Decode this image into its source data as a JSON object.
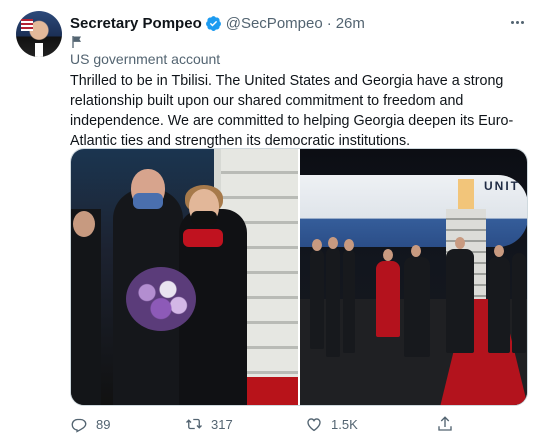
{
  "author": {
    "name": "Secretary Pompeo",
    "handle": "@SecPompeo",
    "separator": "·",
    "time": "26m",
    "account_label": "US government account"
  },
  "tweet": {
    "text": "Thrilled to be in Tbilisi. The United States and Georgia have a strong relationship built upon our shared commitment to freedom and independence. We are committed to helping Georgia deepen its Euro-Atlantic ties and strengthen its democratic institutions."
  },
  "media": {
    "plane_lettering": "UNIT"
  },
  "actions": {
    "reply_count": "89",
    "retweet_count": "317",
    "like_count": "1.5K"
  },
  "colors": {
    "verified": "#1d9bf0",
    "secondary_text": "#536471",
    "primary_text": "#0f1419",
    "carpet_red": "#b3131d"
  },
  "icons": [
    "verified-badge-icon",
    "more-icon",
    "flag-icon",
    "reply-icon",
    "retweet-icon",
    "like-icon",
    "share-icon"
  ]
}
